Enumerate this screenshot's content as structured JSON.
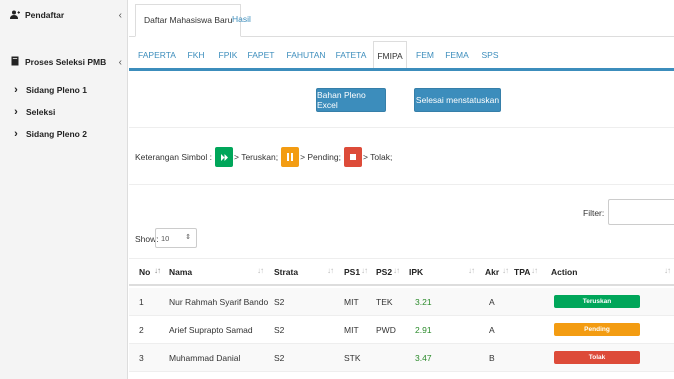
{
  "sidebar": {
    "items": [
      {
        "label": "Pendaftar",
        "icon": "user-plus-icon"
      },
      {
        "label": "Proses Seleksi PMB",
        "icon": "book-icon"
      },
      {
        "label": "Sidang Pleno 1",
        "icon": "chevron-right-icon"
      },
      {
        "label": "Seleksi",
        "icon": "chevron-right-icon"
      },
      {
        "label": "Sidang Pleno 2",
        "icon": "chevron-right-icon"
      }
    ]
  },
  "top_tabs": [
    {
      "label": "Daftar Mahasiswa Baru",
      "active": true
    },
    {
      "label": "Hasil",
      "active": false
    }
  ],
  "faculty_tabs": [
    "FAPERTA",
    "FKH",
    "FPIK",
    "FAPET",
    "FAHUTAN",
    "FATETA",
    "FMIPA",
    "FEM",
    "FEMA",
    "SPS"
  ],
  "active_faculty": "FMIPA",
  "buttons": {
    "excel": "Bahan Pleno Excel",
    "finish": "Selesai menstatuskan"
  },
  "legend": {
    "prefix": "Keterangan Simbol :",
    "items": [
      {
        "text": "> Teruskan;",
        "color": "#00a65a",
        "icon": "play-icon"
      },
      {
        "text": "> Pending;",
        "color": "#f39c12",
        "icon": "pause-icon"
      },
      {
        "text": "> Tolak;",
        "color": "#dd4b39",
        "icon": "stop-icon"
      }
    ]
  },
  "filter": {
    "label": "Filter:",
    "value": ""
  },
  "show": {
    "label": "Show:",
    "value": "10"
  },
  "table": {
    "headers": [
      "No",
      "Nama",
      "Strata",
      "PS1",
      "PS2",
      "IPK",
      "Akr",
      "TPA",
      "Action"
    ],
    "rows": [
      {
        "no": "1",
        "nama": "Nur Rahmah Syarif Bando",
        "strata": "S2",
        "ps1": "MIT",
        "ps2": "TEK",
        "ipk": "3.21",
        "akr": "A",
        "tpa": "",
        "action": "Teruskan",
        "action_color": "#00a65a"
      },
      {
        "no": "2",
        "nama": "Arief Suprapto Samad",
        "strata": "S2",
        "ps1": "MIT",
        "ps2": "PWD",
        "ipk": "2.91",
        "akr": "A",
        "tpa": "",
        "action": "Pending",
        "action_color": "#f39c12"
      },
      {
        "no": "3",
        "nama": "Muhammad Danial",
        "strata": "S2",
        "ps1": "STK",
        "ps2": "",
        "ipk": "3.47",
        "akr": "B",
        "tpa": "",
        "action": "Tolak",
        "action_color": "#dd4b39"
      }
    ]
  }
}
